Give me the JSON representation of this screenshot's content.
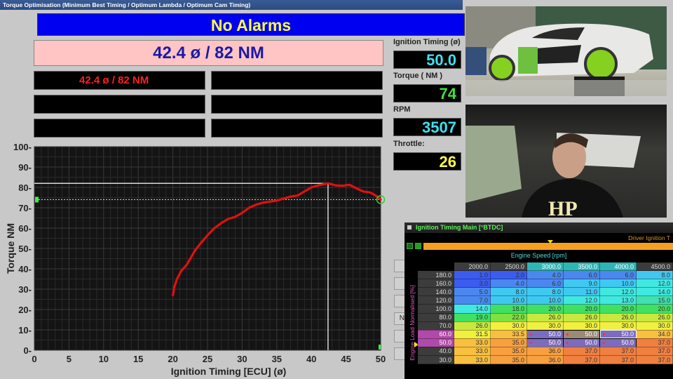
{
  "window": {
    "title": "Torque Optimisation (Minimum Best Timing / Optimum Lambda / Optimum Cam Timing)"
  },
  "alarm": {
    "text": "No Alarms",
    "bg": "#0000f0",
    "fg": "#ffff40"
  },
  "result": {
    "text": "42.4 ø / 82 NM"
  },
  "result_blocks": [
    {
      "text": "42.4 ø / 82 NM"
    },
    {
      "text": ""
    },
    {
      "text": ""
    },
    {
      "text": ""
    },
    {
      "text": ""
    },
    {
      "text": ""
    }
  ],
  "readouts": [
    {
      "label": "Ignition Timing (ø)",
      "value": "50.0",
      "color": "#40e0f0"
    },
    {
      "label": "Torque ( NM )",
      "value": "74",
      "color": "#40e040"
    },
    {
      "label": "RPM",
      "value": "3507",
      "color": "#40e0f0"
    },
    {
      "label": "Throttle:",
      "value": "26",
      "color": "#ffff40"
    }
  ],
  "side_buttons": [
    "",
    "",
    "",
    "N",
    "",
    ""
  ],
  "chart_data": {
    "type": "line",
    "title": "",
    "xlabel": "Ignition Timing [ECU] (ø)",
    "ylabel": "Torque NM",
    "xlim": [
      0,
      50
    ],
    "ylim": [
      0,
      100
    ],
    "xticks": [
      0,
      5,
      10,
      15,
      20,
      25,
      30,
      35,
      40,
      45,
      50
    ],
    "yticks": [
      0,
      10,
      20,
      30,
      40,
      50,
      60,
      70,
      80,
      90,
      100
    ],
    "grid": true,
    "series": [
      {
        "name": "Torque",
        "color": "#e01010",
        "x": [
          20.0,
          20.2,
          20.6,
          21.2,
          22.0,
          22.6,
          23.2,
          24.0,
          25.0,
          26.0,
          27.0,
          28.0,
          29.0,
          30.0,
          31.0,
          32.0,
          33.0,
          34.0,
          35.0,
          36.0,
          37.0,
          38.0,
          39.0,
          40.0,
          41.0,
          42.4,
          43.5,
          44.5,
          45.5,
          46.5,
          47.5,
          48.5,
          49.3,
          50.0
        ],
        "y": [
          27.0,
          31.0,
          35.0,
          39.0,
          42.0,
          45.5,
          49.0,
          52.5,
          56.5,
          60.0,
          62.5,
          64.5,
          65.5,
          67.5,
          70.0,
          71.5,
          72.5,
          73.0,
          73.5,
          74.5,
          75.5,
          76.0,
          78.0,
          80.0,
          81.0,
          82.0,
          81.0,
          80.8,
          81.3,
          79.5,
          78.0,
          77.5,
          76.0,
          74.0
        ]
      }
    ],
    "annotations": [
      {
        "type": "peak-crosshair",
        "x": 42.4,
        "y": 82
      },
      {
        "type": "current-level-dashed",
        "y": 74
      },
      {
        "type": "current-point-marker",
        "x": 50,
        "y": 74
      }
    ]
  },
  "ignition_table": {
    "title": "Ignition Timing Main [°BTDC]",
    "driver_label": "Driver Ignition T",
    "x_axis_label": "Engine Speed [rpm]",
    "y_axis_label": "Engine Load Normalised [%]",
    "columns": [
      "2000.0",
      "2500.0",
      "3000.0",
      "3500.0",
      "4000.0",
      "4500.0"
    ],
    "selected_columns": [
      2,
      3,
      4
    ],
    "rows": [
      {
        "load": "180.0",
        "values": [
          "1.0",
          "2.0",
          "4.0",
          "6.0",
          "6.0",
          "8.0"
        ]
      },
      {
        "load": "160.0",
        "values": [
          "3.0",
          "4.0",
          "6.0",
          "9.0",
          "10.0",
          "12.0"
        ]
      },
      {
        "load": "140.0",
        "values": [
          "5.0",
          "8.0",
          "8.0",
          "11.0",
          "12.0",
          "14.0"
        ]
      },
      {
        "load": "120.0",
        "values": [
          "7.0",
          "10.0",
          "10.0",
          "12.0",
          "13.0",
          "15.0"
        ]
      },
      {
        "load": "100.0",
        "values": [
          "14.0",
          "18.0",
          "20.0",
          "20.0",
          "20.0",
          "20.0"
        ]
      },
      {
        "load": "80.0",
        "values": [
          "19.0",
          "22.0",
          "26.0",
          "26.0",
          "26.0",
          "26.0"
        ]
      },
      {
        "load": "70.0",
        "values": [
          "26.0",
          "30.0",
          "30.0",
          "30.0",
          "30.0",
          "30.0"
        ]
      },
      {
        "load": "60.0",
        "values": [
          "31.5",
          "33.5",
          "50.0",
          "50.0",
          "50.0",
          "34.0"
        ]
      },
      {
        "load": "50.0",
        "values": [
          "33.0",
          "35.0",
          "50.0",
          "50.0",
          "50.0",
          "37.0"
        ]
      },
      {
        "load": "40.0",
        "values": [
          "33.0",
          "35.0",
          "36.0",
          "37.0",
          "37.0",
          "37.0"
        ]
      },
      {
        "load": "30.0",
        "values": [
          "33.0",
          "35.0",
          "36.0",
          "37.0",
          "37.0",
          "37.0"
        ]
      }
    ],
    "selected_rows": [
      7,
      8
    ]
  },
  "video_feeds": [
    {
      "name": "dyno-camera",
      "description": "Car on dyno"
    },
    {
      "name": "driver-camera",
      "description": "Driver in cabin"
    }
  ]
}
